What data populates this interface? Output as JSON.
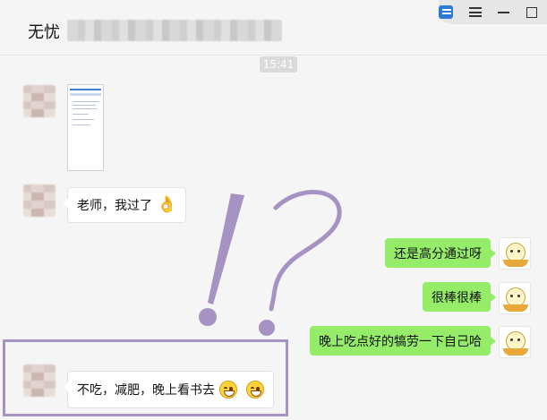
{
  "header": {
    "title": "无忧"
  },
  "window_controls": [
    "mini-program-icon",
    "menu-icon",
    "minimize-icon",
    "maximize-icon"
  ],
  "chat": {
    "timestamp": "15:41",
    "messages": [
      {
        "side": "left",
        "kind": "image",
        "content": "document-screenshot"
      },
      {
        "side": "left",
        "kind": "text",
        "text": "老师，我过了",
        "emoji": "ok-hand-emoji"
      },
      {
        "side": "right",
        "kind": "text",
        "text": "还是高分通过呀"
      },
      {
        "side": "right",
        "kind": "text",
        "text": "很棒很棒"
      },
      {
        "side": "right",
        "kind": "text",
        "text": "晚上吃点好的犒劳一下自己哈"
      },
      {
        "side": "left",
        "kind": "text",
        "text": "不吃，减肥，晚上看书去",
        "emoji": "grin-emoji x2"
      }
    ]
  },
  "colors": {
    "self_bubble": "#95ec69",
    "other_bubble": "#ffffff",
    "annotation": "#a693c3",
    "background": "#f5f5f5"
  }
}
